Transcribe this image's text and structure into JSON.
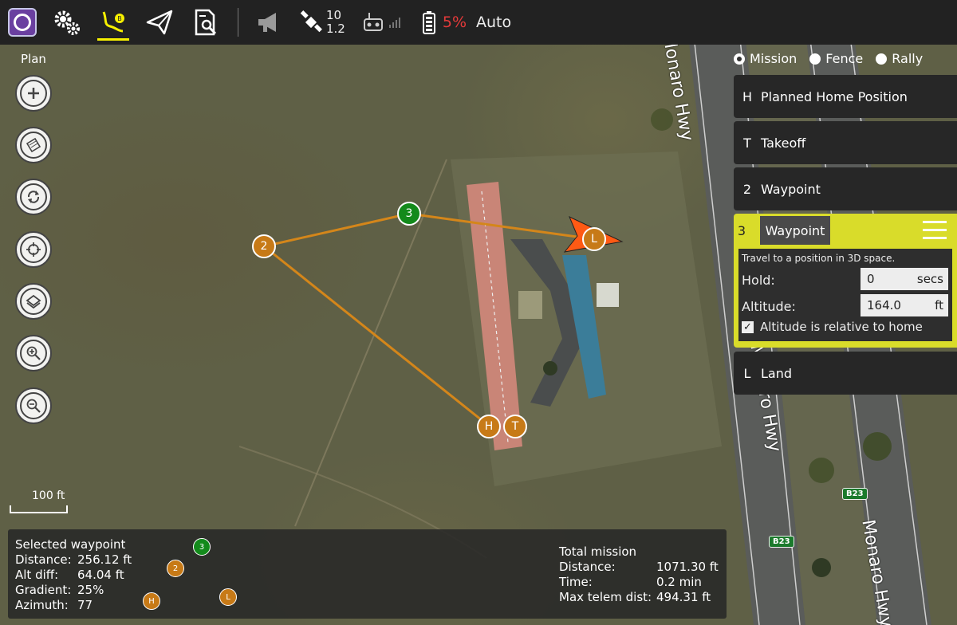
{
  "toolbar": {
    "gps_count": "10",
    "gps_hdop": "1.2",
    "battery_percent": "5%",
    "flight_mode": "Auto",
    "colors": {
      "background": "#222222",
      "active_underline": "#f7f000",
      "battery_warn": "#e53a3a"
    },
    "icons": [
      "qgc-logo-icon",
      "gear-icon",
      "plan-route-icon",
      "paper-plane-icon",
      "analyze-icon",
      "megaphone-icon",
      "satellite-icon",
      "rc-transmitter-icon",
      "signal-bars-icon",
      "battery-icon"
    ]
  },
  "plan": {
    "label": "Plan",
    "tools": [
      "add-waypoint-icon",
      "pattern-icon",
      "sync-icon",
      "center-icon",
      "layers-icon",
      "zoom-in-icon",
      "zoom-out-icon"
    ]
  },
  "map": {
    "scale_label": "100 ft",
    "road_name": "Monaro Hwy",
    "road_badge": "B23",
    "markers": {
      "home": "H",
      "takeoff": "T",
      "wp2": "2",
      "wp3": "3",
      "land": "L"
    }
  },
  "right_panel": {
    "modes": [
      {
        "label": "Mission",
        "selected": true
      },
      {
        "label": "Fence",
        "selected": false
      },
      {
        "label": "Rally",
        "selected": false
      }
    ],
    "items": [
      {
        "seq": "H",
        "label": "Planned Home Position"
      },
      {
        "seq": "T",
        "label": "Takeoff"
      },
      {
        "seq": "2",
        "label": "Waypoint"
      },
      {
        "seq": "L",
        "label": "Land"
      }
    ],
    "selected_item": {
      "seq": "3",
      "command": "Waypoint",
      "description": "Travel to a position in 3D space.",
      "hold_label": "Hold:",
      "hold_value": "0",
      "hold_unit": "secs",
      "altitude_label": "Altitude:",
      "altitude_value": "164.0",
      "altitude_unit": "ft",
      "relative_checked": true,
      "relative_label": "Altitude is relative to home",
      "highlight_color": "#d9dc2a"
    }
  },
  "selected_waypoint": {
    "title": "Selected waypoint",
    "distance_label": "Distance:",
    "distance_value": "256.12 ft",
    "alt_diff_label": "Alt diff:",
    "alt_diff_value": "64.04 ft",
    "gradient_label": "Gradient:",
    "gradient_value": "25%",
    "azimuth_label": "Azimuth:",
    "azimuth_value": "77"
  },
  "total_mission": {
    "title": "Total mission",
    "distance_label": "Distance:",
    "distance_value": "1071.30 ft",
    "time_label": "Time:",
    "time_value": "0.2 min",
    "max_telem_label": "Max telem dist:",
    "max_telem_value": "494.31 ft"
  }
}
